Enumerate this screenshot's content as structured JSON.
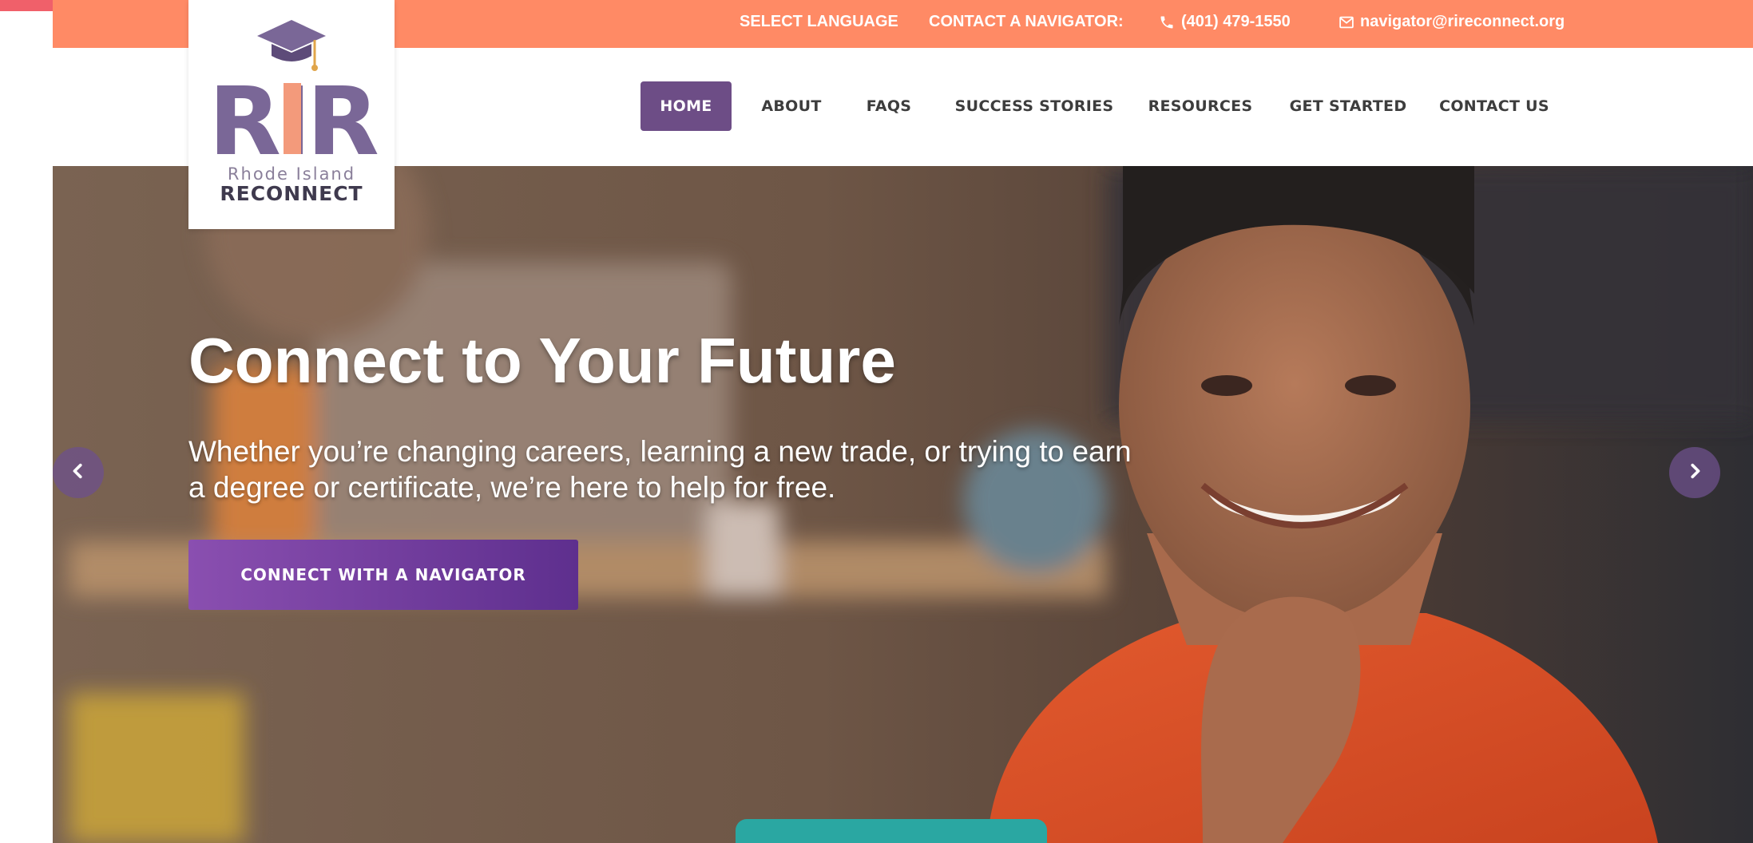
{
  "topbar": {
    "select_language": "SELECT LANGUAGE",
    "contact_label": "CONTACT A NAVIGATOR:",
    "phone": "(401) 479-1550",
    "email": "navigator@rireconnect.org"
  },
  "logo": {
    "monogram": "RIR",
    "tagline_top": "Rhode Island",
    "tagline_bottom": "RECONNECT"
  },
  "nav": {
    "items": [
      {
        "label": "HOME",
        "active": true
      },
      {
        "label": "ABOUT",
        "active": false
      },
      {
        "label": "FAQS",
        "active": false
      },
      {
        "label": "SUCCESS STORIES",
        "active": false
      },
      {
        "label": "RESOURCES",
        "active": false
      },
      {
        "label": "GET STARTED",
        "active": false
      },
      {
        "label": "CONTACT US",
        "active": false
      }
    ]
  },
  "hero": {
    "title": "Connect to Your Future",
    "subtitle": "Whether you’re changing careers, learning a new trade, or trying to earn a degree or certificate, we’re here to help for free.",
    "cta_label": "CONNECT WITH A NAVIGATOR"
  },
  "colors": {
    "topbar": "#ff8a65",
    "brand_purple": "#6d4d86",
    "cta_start": "#8a4fb0",
    "cta_end": "#5e2f8e",
    "logo_coral": "#f39a7b",
    "logo_purple": "#7a6797"
  },
  "icons": {
    "phone": "phone-icon",
    "mail": "mail-icon",
    "grad_cap": "graduation-cap-icon",
    "prev": "chevron-left-icon",
    "next": "chevron-right-icon"
  }
}
